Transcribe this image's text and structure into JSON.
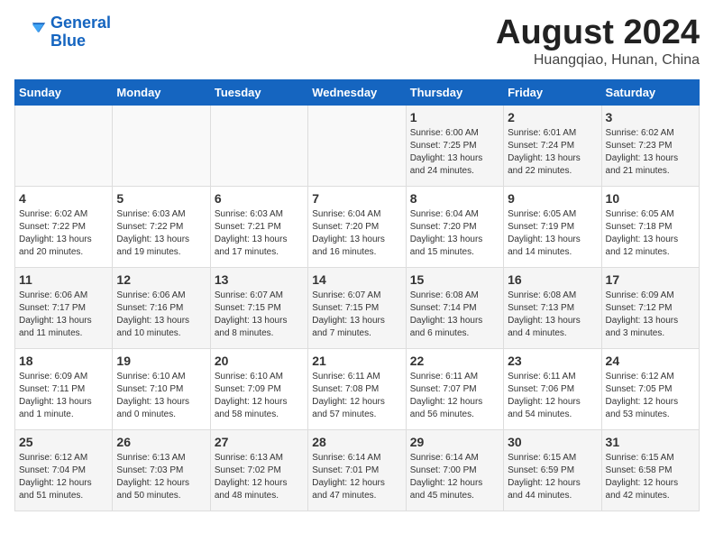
{
  "header": {
    "logo_line1": "General",
    "logo_line2": "Blue",
    "title": "August 2024",
    "subtitle": "Huangqiao, Hunan, China"
  },
  "weekdays": [
    "Sunday",
    "Monday",
    "Tuesday",
    "Wednesday",
    "Thursday",
    "Friday",
    "Saturday"
  ],
  "weeks": [
    [
      {
        "day": "",
        "info": ""
      },
      {
        "day": "",
        "info": ""
      },
      {
        "day": "",
        "info": ""
      },
      {
        "day": "",
        "info": ""
      },
      {
        "day": "1",
        "info": "Sunrise: 6:00 AM\nSunset: 7:25 PM\nDaylight: 13 hours\nand 24 minutes."
      },
      {
        "day": "2",
        "info": "Sunrise: 6:01 AM\nSunset: 7:24 PM\nDaylight: 13 hours\nand 22 minutes."
      },
      {
        "day": "3",
        "info": "Sunrise: 6:02 AM\nSunset: 7:23 PM\nDaylight: 13 hours\nand 21 minutes."
      }
    ],
    [
      {
        "day": "4",
        "info": "Sunrise: 6:02 AM\nSunset: 7:22 PM\nDaylight: 13 hours\nand 20 minutes."
      },
      {
        "day": "5",
        "info": "Sunrise: 6:03 AM\nSunset: 7:22 PM\nDaylight: 13 hours\nand 19 minutes."
      },
      {
        "day": "6",
        "info": "Sunrise: 6:03 AM\nSunset: 7:21 PM\nDaylight: 13 hours\nand 17 minutes."
      },
      {
        "day": "7",
        "info": "Sunrise: 6:04 AM\nSunset: 7:20 PM\nDaylight: 13 hours\nand 16 minutes."
      },
      {
        "day": "8",
        "info": "Sunrise: 6:04 AM\nSunset: 7:20 PM\nDaylight: 13 hours\nand 15 minutes."
      },
      {
        "day": "9",
        "info": "Sunrise: 6:05 AM\nSunset: 7:19 PM\nDaylight: 13 hours\nand 14 minutes."
      },
      {
        "day": "10",
        "info": "Sunrise: 6:05 AM\nSunset: 7:18 PM\nDaylight: 13 hours\nand 12 minutes."
      }
    ],
    [
      {
        "day": "11",
        "info": "Sunrise: 6:06 AM\nSunset: 7:17 PM\nDaylight: 13 hours\nand 11 minutes."
      },
      {
        "day": "12",
        "info": "Sunrise: 6:06 AM\nSunset: 7:16 PM\nDaylight: 13 hours\nand 10 minutes."
      },
      {
        "day": "13",
        "info": "Sunrise: 6:07 AM\nSunset: 7:15 PM\nDaylight: 13 hours\nand 8 minutes."
      },
      {
        "day": "14",
        "info": "Sunrise: 6:07 AM\nSunset: 7:15 PM\nDaylight: 13 hours\nand 7 minutes."
      },
      {
        "day": "15",
        "info": "Sunrise: 6:08 AM\nSunset: 7:14 PM\nDaylight: 13 hours\nand 6 minutes."
      },
      {
        "day": "16",
        "info": "Sunrise: 6:08 AM\nSunset: 7:13 PM\nDaylight: 13 hours\nand 4 minutes."
      },
      {
        "day": "17",
        "info": "Sunrise: 6:09 AM\nSunset: 7:12 PM\nDaylight: 13 hours\nand 3 minutes."
      }
    ],
    [
      {
        "day": "18",
        "info": "Sunrise: 6:09 AM\nSunset: 7:11 PM\nDaylight: 13 hours\nand 1 minute."
      },
      {
        "day": "19",
        "info": "Sunrise: 6:10 AM\nSunset: 7:10 PM\nDaylight: 13 hours\nand 0 minutes."
      },
      {
        "day": "20",
        "info": "Sunrise: 6:10 AM\nSunset: 7:09 PM\nDaylight: 12 hours\nand 58 minutes."
      },
      {
        "day": "21",
        "info": "Sunrise: 6:11 AM\nSunset: 7:08 PM\nDaylight: 12 hours\nand 57 minutes."
      },
      {
        "day": "22",
        "info": "Sunrise: 6:11 AM\nSunset: 7:07 PM\nDaylight: 12 hours\nand 56 minutes."
      },
      {
        "day": "23",
        "info": "Sunrise: 6:11 AM\nSunset: 7:06 PM\nDaylight: 12 hours\nand 54 minutes."
      },
      {
        "day": "24",
        "info": "Sunrise: 6:12 AM\nSunset: 7:05 PM\nDaylight: 12 hours\nand 53 minutes."
      }
    ],
    [
      {
        "day": "25",
        "info": "Sunrise: 6:12 AM\nSunset: 7:04 PM\nDaylight: 12 hours\nand 51 minutes."
      },
      {
        "day": "26",
        "info": "Sunrise: 6:13 AM\nSunset: 7:03 PM\nDaylight: 12 hours\nand 50 minutes."
      },
      {
        "day": "27",
        "info": "Sunrise: 6:13 AM\nSunset: 7:02 PM\nDaylight: 12 hours\nand 48 minutes."
      },
      {
        "day": "28",
        "info": "Sunrise: 6:14 AM\nSunset: 7:01 PM\nDaylight: 12 hours\nand 47 minutes."
      },
      {
        "day": "29",
        "info": "Sunrise: 6:14 AM\nSunset: 7:00 PM\nDaylight: 12 hours\nand 45 minutes."
      },
      {
        "day": "30",
        "info": "Sunrise: 6:15 AM\nSunset: 6:59 PM\nDaylight: 12 hours\nand 44 minutes."
      },
      {
        "day": "31",
        "info": "Sunrise: 6:15 AM\nSunset: 6:58 PM\nDaylight: 12 hours\nand 42 minutes."
      }
    ]
  ]
}
